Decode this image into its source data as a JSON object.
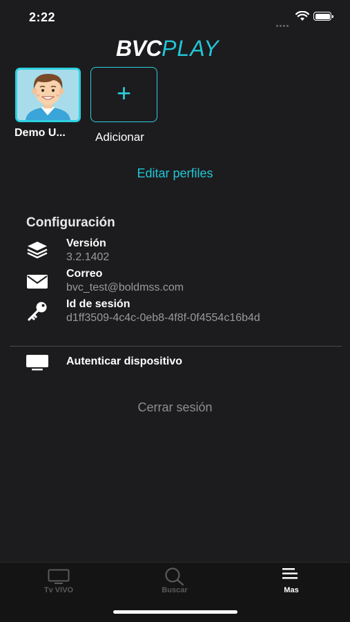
{
  "status_bar": {
    "time": "2:22"
  },
  "logo": {
    "part1": "BVC",
    "part2": "PLAY"
  },
  "profiles": [
    {
      "name": "Demo U..."
    }
  ],
  "add_profile": {
    "symbol": "+",
    "label": "Adicionar"
  },
  "edit_profiles_label": "Editar perfiles",
  "config": {
    "title": "Configuración",
    "items": [
      {
        "icon": "layers-icon",
        "title": "Versión",
        "value": "3.2.1402"
      },
      {
        "icon": "mail-icon",
        "title": "Correo",
        "value": "bvc_test@boldmss.com"
      },
      {
        "icon": "key-icon",
        "title": "Id de sesión",
        "value": "d1ff3509-4c4c-0eb8-4f8f-0f4554c16b4d"
      }
    ]
  },
  "authenticate_device": {
    "icon": "tv-icon",
    "label": "Autenticar dispositivo"
  },
  "logout_label": "Cerrar sesión",
  "tabs": [
    {
      "icon": "tv-icon",
      "label": "Tv VIVO",
      "active": false
    },
    {
      "icon": "search-icon",
      "label": "Buscar",
      "active": false
    },
    {
      "icon": "menu-icon",
      "label": "Mas",
      "active": true
    }
  ],
  "colors": {
    "accent": "#22c6d6",
    "background": "#1c1c1e",
    "tabbar": "#141414"
  }
}
